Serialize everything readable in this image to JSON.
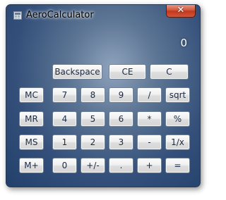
{
  "window": {
    "title": "AeroCalculator",
    "close_label": "✕"
  },
  "display": {
    "value": "0"
  },
  "top_buttons": {
    "backspace": "Backspace",
    "ce": "CE",
    "c": "C"
  },
  "memory_buttons": {
    "mc": "MC",
    "mr": "MR",
    "ms": "MS",
    "mplus": "M+"
  },
  "keypad": {
    "row1": [
      "7",
      "8",
      "9",
      "/",
      "sqrt"
    ],
    "row2": [
      "4",
      "5",
      "6",
      "*",
      "%"
    ],
    "row3": [
      "1",
      "2",
      "3",
      "-",
      "1/x"
    ],
    "row4": [
      "0",
      "+/-",
      ".",
      "+",
      "="
    ]
  },
  "colors": {
    "accent": "#34507a",
    "close": "#c0391e"
  }
}
